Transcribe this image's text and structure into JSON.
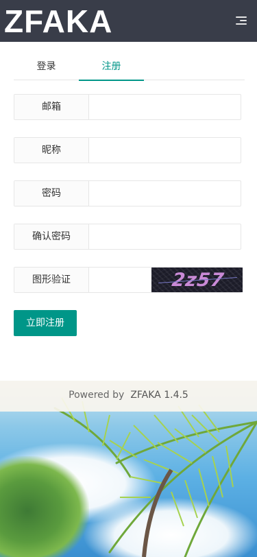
{
  "header": {
    "logo": "ZFAKA",
    "menu_icon": "menu-fold-icon"
  },
  "tabs": [
    {
      "label": "登录",
      "active": false
    },
    {
      "label": "注册",
      "active": true
    }
  ],
  "form": {
    "email_label": "邮箱",
    "email_value": "",
    "nickname_label": "昵称",
    "nickname_value": "",
    "password_label": "密码",
    "password_value": "",
    "confirm_label": "确认密码",
    "confirm_value": "",
    "captcha_label": "图形验证",
    "captcha_value": "",
    "captcha_code": "2z57",
    "submit_label": "立即注册"
  },
  "footer": {
    "powered_by": "Powered by",
    "brand": "ZFAKA 1.4.5"
  },
  "colors": {
    "header_bg": "#393d49",
    "accent": "#009688"
  }
}
